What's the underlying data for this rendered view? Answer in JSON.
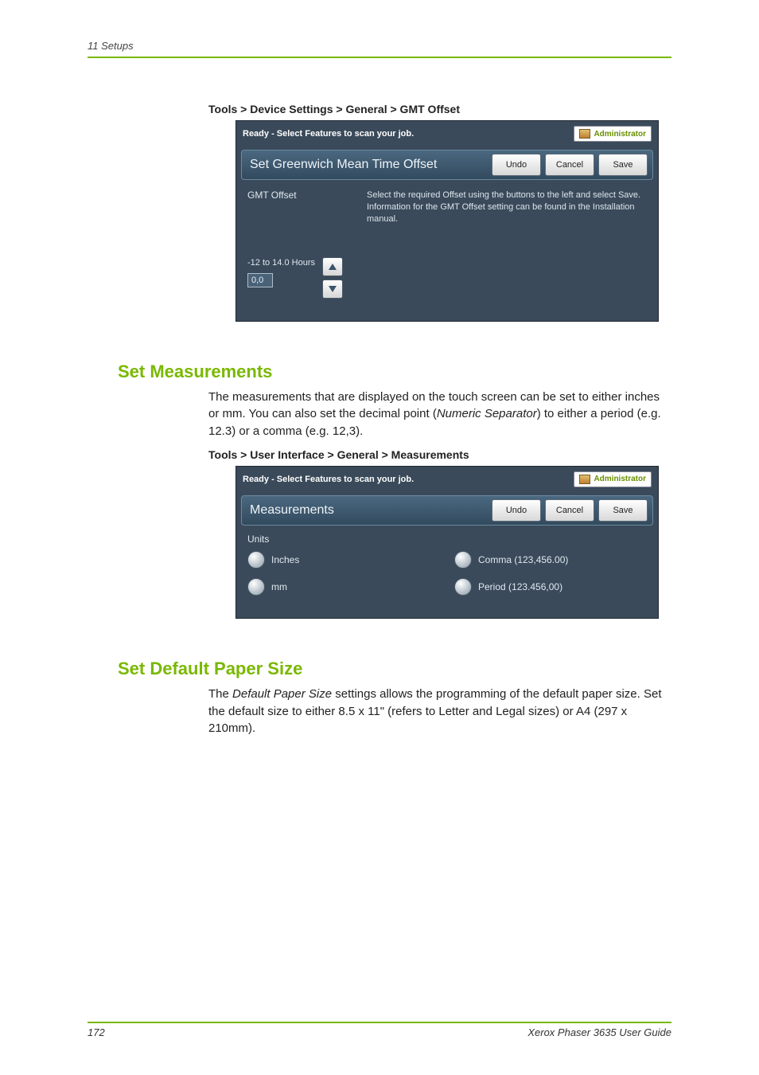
{
  "running_head": "11   Setups",
  "breadcrumb_gmt": "Tools > Device Settings > General > GMT Offset",
  "panel_common": {
    "status_text": "Ready - Select Features to scan your job.",
    "admin_label": "Administrator",
    "undo": "Undo",
    "cancel": "Cancel",
    "save": "Save"
  },
  "gmt_panel": {
    "title": "Set Greenwich Mean Time Offset",
    "label": "GMT Offset",
    "help": "Select the required Offset using the buttons to the left and select Save. Information for the GMT Offset setting can be found in the Installation manual.",
    "range": "-12 to 14.0 Hours",
    "value": "0,0"
  },
  "section_measurements": {
    "heading": "Set Measurements",
    "body_html": "The measurements that are displayed on the touch screen can be set to either inches or mm. You can also set the decimal point (<em>Numeric Separator</em>) to either a period (e.g. 12.3) or a comma (e.g. 12,3).",
    "breadcrumb": "Tools > User Interface > General > Measurements"
  },
  "mea_panel": {
    "title": "Measurements",
    "units_label": "Units",
    "unit_options": [
      "Inches",
      "mm"
    ],
    "separator_options": [
      "Comma (123,456.00)",
      "Period (123.456,00)"
    ]
  },
  "section_paper": {
    "heading": "Set Default Paper Size",
    "body_html": "The <em>Default Paper Size</em> settings allows the programming of the default paper size. Set the default size to either 8.5 x 11\" (refers to Letter and Legal sizes) or A4 (297 x 210mm)."
  },
  "footer": {
    "page": "172",
    "guide": "Xerox Phaser 3635 User Guide"
  }
}
